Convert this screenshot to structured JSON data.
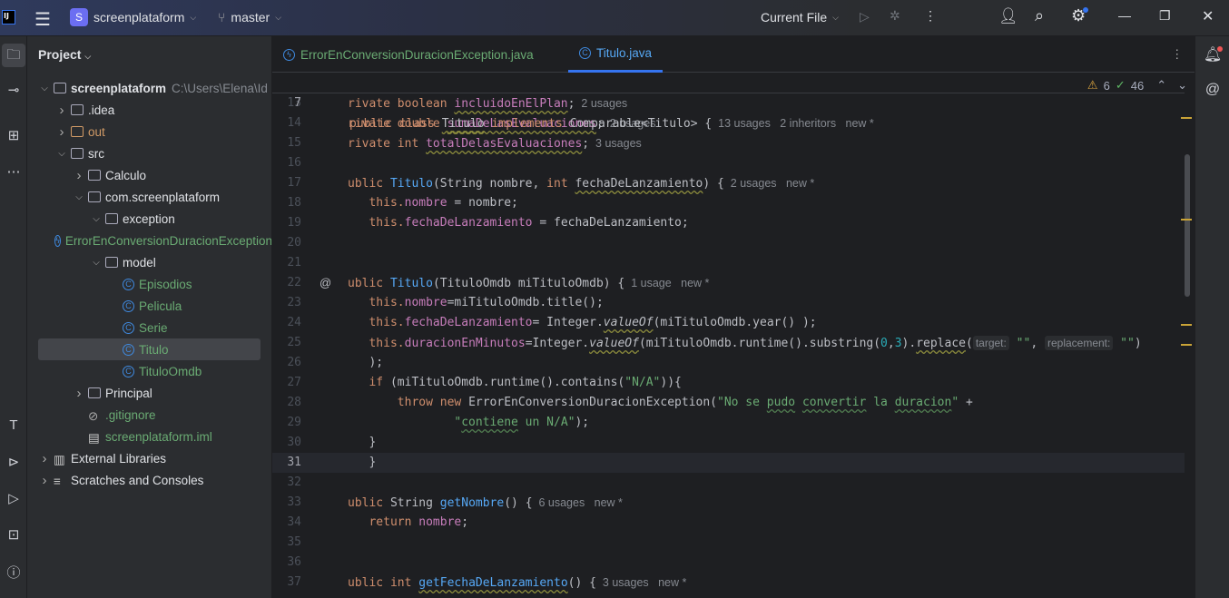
{
  "topbar": {
    "project": "screenplataform",
    "project_initial": "S",
    "branch": "master",
    "run_config": "Current File"
  },
  "panel": {
    "title": "Project"
  },
  "tree": [
    {
      "label": "screenplataform",
      "path": "C:\\Users\\Elena\\Id",
      "level": 0,
      "arrow": "down",
      "icon": "module-folder",
      "bold": true
    },
    {
      "label": ".idea",
      "level": 1,
      "arrow": "right",
      "icon": "folder"
    },
    {
      "label": "out",
      "level": 1,
      "arrow": "right",
      "icon": "folder-excluded",
      "color": "orange"
    },
    {
      "label": "src",
      "level": 1,
      "arrow": "down",
      "icon": "folder"
    },
    {
      "label": "Calculo",
      "level": 2,
      "arrow": "right",
      "icon": "package"
    },
    {
      "label": "com.screenplataform",
      "level": 2,
      "arrow": "down",
      "icon": "package"
    },
    {
      "label": "exception",
      "level": 3,
      "arrow": "down",
      "icon": "package"
    },
    {
      "label": "ErrorEnConversionDuracionException",
      "level": 4,
      "icon": "exception-class",
      "color": "green"
    },
    {
      "label": "model",
      "level": 3,
      "arrow": "down",
      "icon": "package"
    },
    {
      "label": "Episodios",
      "level": 4,
      "icon": "class",
      "color": "green"
    },
    {
      "label": "Pelicula",
      "level": 4,
      "icon": "class",
      "color": "green"
    },
    {
      "label": "Serie",
      "level": 4,
      "icon": "class",
      "color": "green"
    },
    {
      "label": "Titulo",
      "level": 4,
      "icon": "class",
      "color": "green",
      "selected": true
    },
    {
      "label": "TituloOmdb",
      "level": 4,
      "icon": "record",
      "color": "green"
    },
    {
      "label": "Principal",
      "level": 2,
      "arrow": "right",
      "icon": "package"
    },
    {
      "label": ".gitignore",
      "level": 2,
      "icon": "gitignore-file",
      "color": "green"
    },
    {
      "label": "screenplataform.iml",
      "level": 2,
      "icon": "iml-file",
      "color": "green"
    },
    {
      "label": "External Libraries",
      "level": 0,
      "arrow": "right",
      "icon": "library"
    },
    {
      "label": "Scratches and Consoles",
      "level": 0,
      "arrow": "right",
      "icon": "scratches"
    }
  ],
  "tabs": [
    {
      "label": "ErrorEnConversionDuracionException.java",
      "active": false,
      "icon": "exception-class"
    },
    {
      "label": "Titulo.java",
      "active": true,
      "icon": "class"
    }
  ],
  "inspections": {
    "warnings": "6",
    "ok": "46"
  },
  "sticky": {
    "number": "7",
    "tokens": [
      [
        "public class ",
        "kw"
      ],
      [
        "Titulo",
        "plain u"
      ],
      [
        " implements ",
        "kw"
      ],
      [
        "Comparable<Titulo> {",
        "plain"
      ],
      [
        "  13 usages   2 inheritors   new *",
        "hint"
      ]
    ]
  },
  "lines": [
    {
      "n": "13",
      "tokens": [
        [
          "rivate boolean ",
          "kw"
        ],
        [
          "incluidoEnElPlan",
          "fld u"
        ],
        [
          ";",
          "plain"
        ],
        [
          "  2 usages",
          "hint"
        ]
      ]
    },
    {
      "n": "14",
      "tokens": [
        [
          "rivate double ",
          "kw"
        ],
        [
          "sumaDeLasEvaluaciones",
          "fld u"
        ],
        [
          ";",
          "plain"
        ],
        [
          "  2 usages",
          "hint"
        ]
      ]
    },
    {
      "n": "15",
      "tokens": [
        [
          "rivate int ",
          "kw"
        ],
        [
          "totalDelasEvaluaciones",
          "fld u"
        ],
        [
          ";",
          "plain"
        ],
        [
          "  3 usages",
          "hint"
        ]
      ]
    },
    {
      "n": "16",
      "tokens": []
    },
    {
      "n": "17",
      "tokens": [
        [
          "ublic ",
          "kw"
        ],
        [
          "Titulo",
          "fn"
        ],
        [
          "(String nombre, ",
          "plain"
        ],
        [
          "int ",
          "kw"
        ],
        [
          "fechaDeLanzamiento",
          "plain u"
        ],
        [
          ") {",
          "plain"
        ],
        [
          "  2 usages   new *",
          "hint"
        ]
      ]
    },
    {
      "n": "18",
      "tokens": [
        [
          "   this.",
          "kw"
        ],
        [
          "nombre",
          "fld"
        ],
        [
          " = nombre;",
          "plain"
        ]
      ]
    },
    {
      "n": "19",
      "tokens": [
        [
          "   this.",
          "kw"
        ],
        [
          "fechaDeLanzamiento",
          "fld"
        ],
        [
          " = fechaDeLanzamiento;",
          "plain"
        ]
      ]
    },
    {
      "n": "20",
      "tokens": []
    },
    {
      "n": "21",
      "tokens": []
    },
    {
      "n": "22",
      "at": "@",
      "tokens": [
        [
          "ublic ",
          "kw"
        ],
        [
          "Titulo",
          "fn"
        ],
        [
          "(TituloOmdb miTituloOmdb) {",
          "plain"
        ],
        [
          "  1 usage   new *",
          "hint"
        ]
      ]
    },
    {
      "n": "23",
      "tokens": [
        [
          "   this.",
          "kw"
        ],
        [
          "nombre",
          "fld"
        ],
        [
          "=miTituloOmdb.title();",
          "plain"
        ]
      ]
    },
    {
      "n": "24",
      "tokens": [
        [
          "   this.",
          "kw"
        ],
        [
          "fechaDeLanzamiento",
          "fld"
        ],
        [
          "= Integer.",
          "plain"
        ],
        [
          "valueOf",
          "plain it u"
        ],
        [
          "(miTituloOmdb.year() );",
          "plain"
        ]
      ]
    },
    {
      "n": "25",
      "tokens": [
        [
          "   this.",
          "kw"
        ],
        [
          "duracionEnMinutos",
          "fld"
        ],
        [
          "=Integer.",
          "plain"
        ],
        [
          "valueOf",
          "plain it u"
        ],
        [
          "(miTituloOmdb.runtime().substring(",
          "plain"
        ],
        [
          "0",
          "num"
        ],
        [
          ",",
          "plain"
        ],
        [
          "3",
          "num"
        ],
        [
          ").",
          "plain"
        ],
        [
          "replace",
          "plain u"
        ],
        [
          "(",
          "plain"
        ],
        [
          "target:",
          "param"
        ],
        [
          " \"\"",
          "str"
        ],
        [
          ", ",
          "plain"
        ],
        [
          "replacement:",
          "param"
        ],
        [
          " \"\"",
          "str"
        ],
        [
          ")",
          "plain"
        ]
      ]
    },
    {
      "n": "26",
      "tokens": [
        [
          "   );",
          "plain"
        ]
      ]
    },
    {
      "n": "27",
      "tokens": [
        [
          "   if ",
          "kw"
        ],
        [
          "(miTituloOmdb.runtime().contains(",
          "plain"
        ],
        [
          "\"N/A\"",
          "str"
        ],
        [
          ")){",
          "plain"
        ]
      ]
    },
    {
      "n": "28",
      "tokens": [
        [
          "       throw new ",
          "kw"
        ],
        [
          "ErrorEnConversionDuracionException(",
          "plain"
        ],
        [
          "\"No se ",
          "str"
        ],
        [
          "pudo",
          "str ug"
        ],
        [
          " ",
          "str"
        ],
        [
          "convertir",
          "str ug"
        ],
        [
          " la ",
          "str"
        ],
        [
          "duracion",
          "str ug"
        ],
        [
          "\"",
          "str"
        ],
        [
          " +",
          "plain"
        ]
      ]
    },
    {
      "n": "29",
      "tokens": [
        [
          "               \"",
          "str"
        ],
        [
          "contiene",
          "str ug"
        ],
        [
          " un N/A\"",
          "str"
        ],
        [
          ");",
          "plain"
        ]
      ]
    },
    {
      "n": "30",
      "tokens": [
        [
          "   }",
          "plain"
        ]
      ]
    },
    {
      "n": "31",
      "current": true,
      "tokens": [
        [
          "   }",
          "plain"
        ]
      ]
    },
    {
      "n": "32",
      "tokens": []
    },
    {
      "n": "33",
      "tokens": [
        [
          "ublic ",
          "kw"
        ],
        [
          "String ",
          "plain"
        ],
        [
          "getNombre",
          "fn"
        ],
        [
          "() {",
          "plain"
        ],
        [
          "  6 usages   new *",
          "hint"
        ]
      ]
    },
    {
      "n": "34",
      "tokens": [
        [
          "   return ",
          "kw"
        ],
        [
          "nombre",
          "fld"
        ],
        [
          ";",
          "plain"
        ]
      ]
    },
    {
      "n": "35",
      "tokens": []
    },
    {
      "n": "36",
      "tokens": []
    },
    {
      "n": "37",
      "tokens": [
        [
          "ublic int ",
          "kw"
        ],
        [
          "getFechaDeLanzamiento",
          "fn u"
        ],
        [
          "() {",
          "plain"
        ],
        [
          "  3 usages   new *",
          "hint"
        ]
      ]
    }
  ]
}
